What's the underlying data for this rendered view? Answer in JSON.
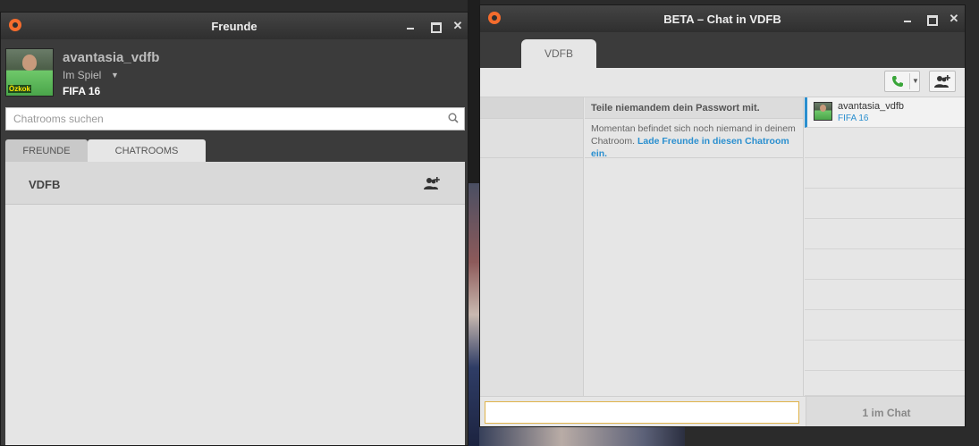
{
  "friends_window": {
    "title": "Freunde",
    "profile": {
      "username": "avantasia_vdfb",
      "status": "Im Spiel",
      "game": "FIFA 16",
      "avatar_badge": "Özkok"
    },
    "search": {
      "placeholder": "Chatrooms suchen",
      "value": ""
    },
    "tabs": [
      {
        "label": "FREUNDE",
        "active": false
      },
      {
        "label": "CHATROOMS",
        "active": true
      }
    ],
    "chatrooms": [
      {
        "name": "VDFB"
      }
    ]
  },
  "chat_window": {
    "title": "BETA – Chat in VDFB",
    "tab": "VDFB",
    "password_warning": "Teile niemandem dein Passwort mit.",
    "empty_message": "Momentan befindet sich noch niemand in deinem Chatroom.",
    "invite_link": "Lade Freunde in diesen Chatroom ein.",
    "members": [
      {
        "name": "avantasia_vdfb",
        "game": "FIFA 16"
      }
    ],
    "input": {
      "value": ""
    },
    "count_label": "1 im Chat"
  },
  "colors": {
    "titlebar": "#333333",
    "accent_orange": "#f56c2d",
    "link_blue": "#2a8fcf",
    "call_green": "#3aa63a",
    "input_focus": "#e0b34a"
  }
}
